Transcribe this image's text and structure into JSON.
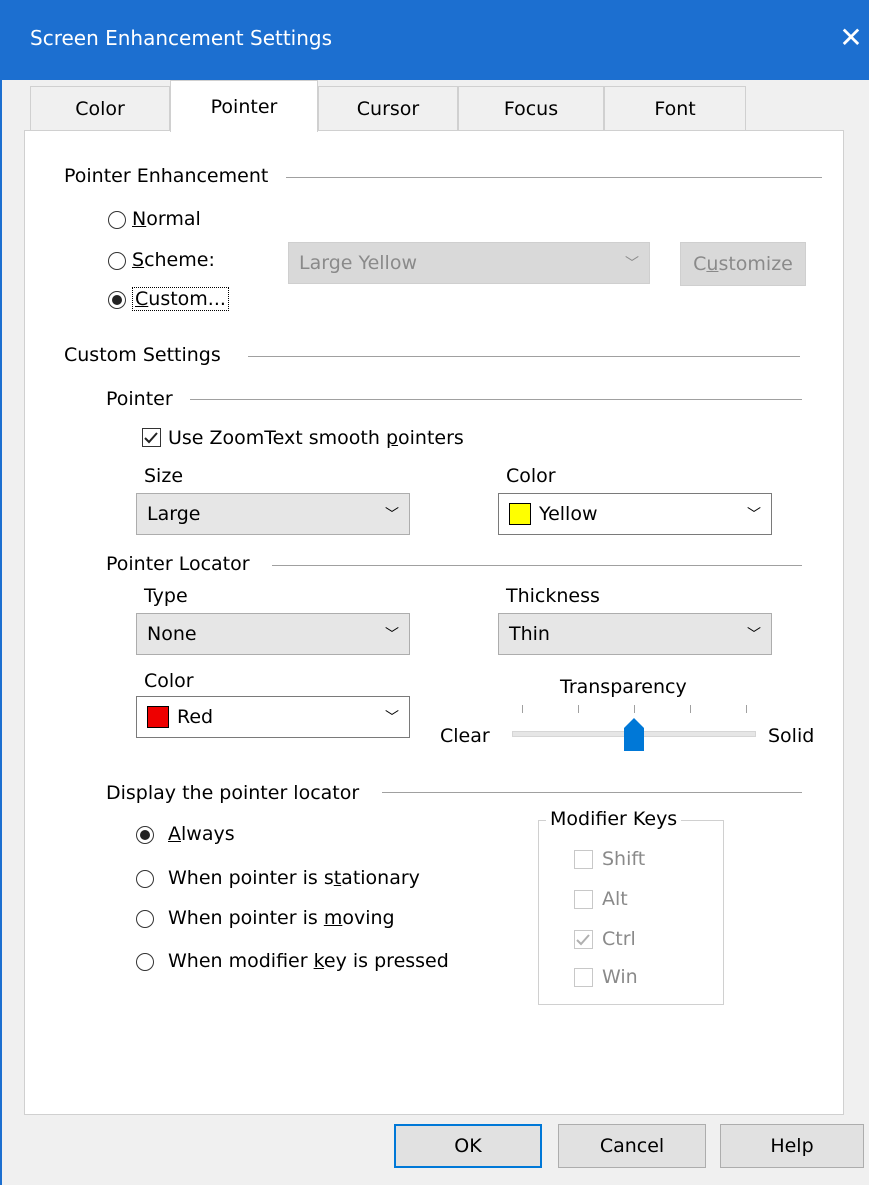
{
  "window": {
    "title": "Screen Enhancement Settings",
    "close_glyph": "✕"
  },
  "tabs": [
    {
      "label": "Color"
    },
    {
      "label": "Pointer"
    },
    {
      "label": "Cursor"
    },
    {
      "label": "Focus"
    },
    {
      "label": "Font"
    }
  ],
  "pointer_enhancement": {
    "heading": "Pointer Enhancement",
    "normal_label": "Normal",
    "scheme_label": "Scheme:",
    "custom_label": "Custom...",
    "scheme_value": "Large Yellow",
    "customize_label": "Customize"
  },
  "custom_settings": {
    "heading": "Custom Settings",
    "pointer": {
      "heading": "Pointer",
      "smooth_label": "Use ZoomText smooth pointers",
      "size_label": "Size",
      "size_value": "Large",
      "color_label": "Color",
      "color_value": "Yellow",
      "color_hex": "#ffff00"
    },
    "locator": {
      "heading": "Pointer Locator",
      "type_label": "Type",
      "type_value": "None",
      "thickness_label": "Thickness",
      "thickness_value": "Thin",
      "color_label": "Color",
      "color_value": "Red",
      "color_hex": "#ee0000",
      "transparency_label": "Transparency",
      "clear_label": "Clear",
      "solid_label": "Solid",
      "transparency_level": 0.5
    },
    "display": {
      "heading": "Display the pointer locator",
      "always_label": "Always",
      "stationary_label": "When pointer is stationary",
      "moving_label": "When pointer is moving",
      "modifier_label": "When modifier key is pressed"
    },
    "modifier_keys": {
      "heading": "Modifier Keys",
      "shift": "Shift",
      "alt": "Alt",
      "ctrl": "Ctrl",
      "win": "Win"
    }
  },
  "buttons": {
    "ok": "OK",
    "cancel": "Cancel",
    "help": "Help"
  },
  "colors": {
    "titlebar": "#1c6fd0",
    "accent": "#0078d7"
  }
}
